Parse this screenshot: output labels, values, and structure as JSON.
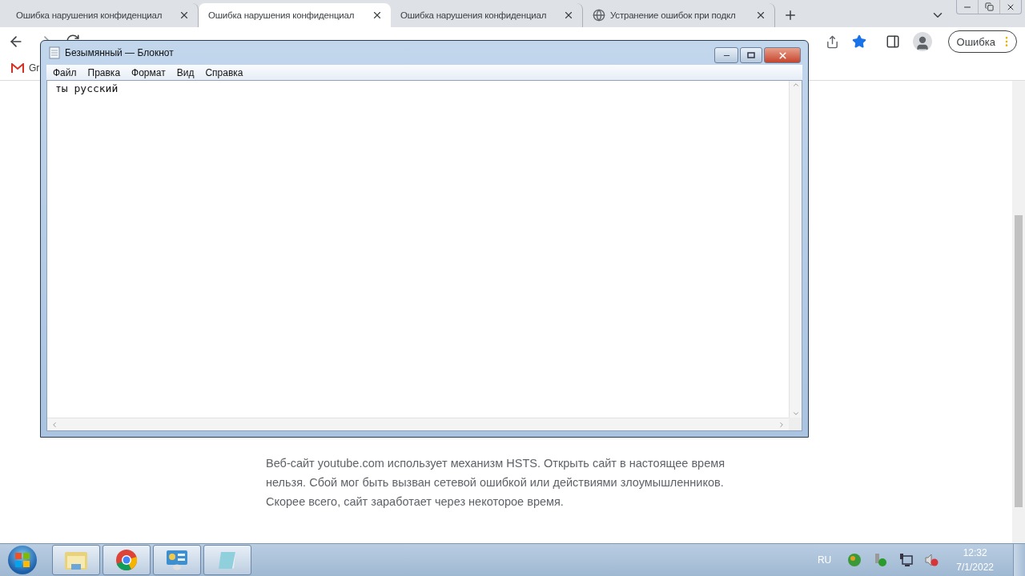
{
  "browser": {
    "tabs": [
      {
        "title": "Ошибка нарушения конфиденциал",
        "selected": false,
        "kind": "page"
      },
      {
        "title": "Ошибка нарушения конфиденциал",
        "selected": true,
        "kind": "page"
      },
      {
        "title": "Ошибка нарушения конфиденциал",
        "selected": false,
        "kind": "page"
      },
      {
        "title": "Устранение ошибок при подкл",
        "selected": false,
        "kind": "web"
      }
    ],
    "error_chip": "Ошибка",
    "bookmarks": [
      {
        "label": "Gr"
      }
    ],
    "page": {
      "paragraph": "Веб-сайт youtube.com использует механизм HSTS. Открыть сайт в настоящее время нельзя. Сбой мог быть вызван сетевой ошибкой или действиями злоумышленников. Скорее всего, сайт заработает через некоторое время."
    }
  },
  "notepad": {
    "title": "Безымянный — Блокнот",
    "menu": [
      "Файл",
      "Правка",
      "Формат",
      "Вид",
      "Справка"
    ],
    "content": "ты русский"
  },
  "taskbar": {
    "apps": [
      {
        "kind": "explorer"
      },
      {
        "kind": "chrome"
      },
      {
        "kind": "panel"
      },
      {
        "kind": "notepad"
      }
    ],
    "language": "RU",
    "time": "12:32",
    "date": "7/1/2022"
  }
}
